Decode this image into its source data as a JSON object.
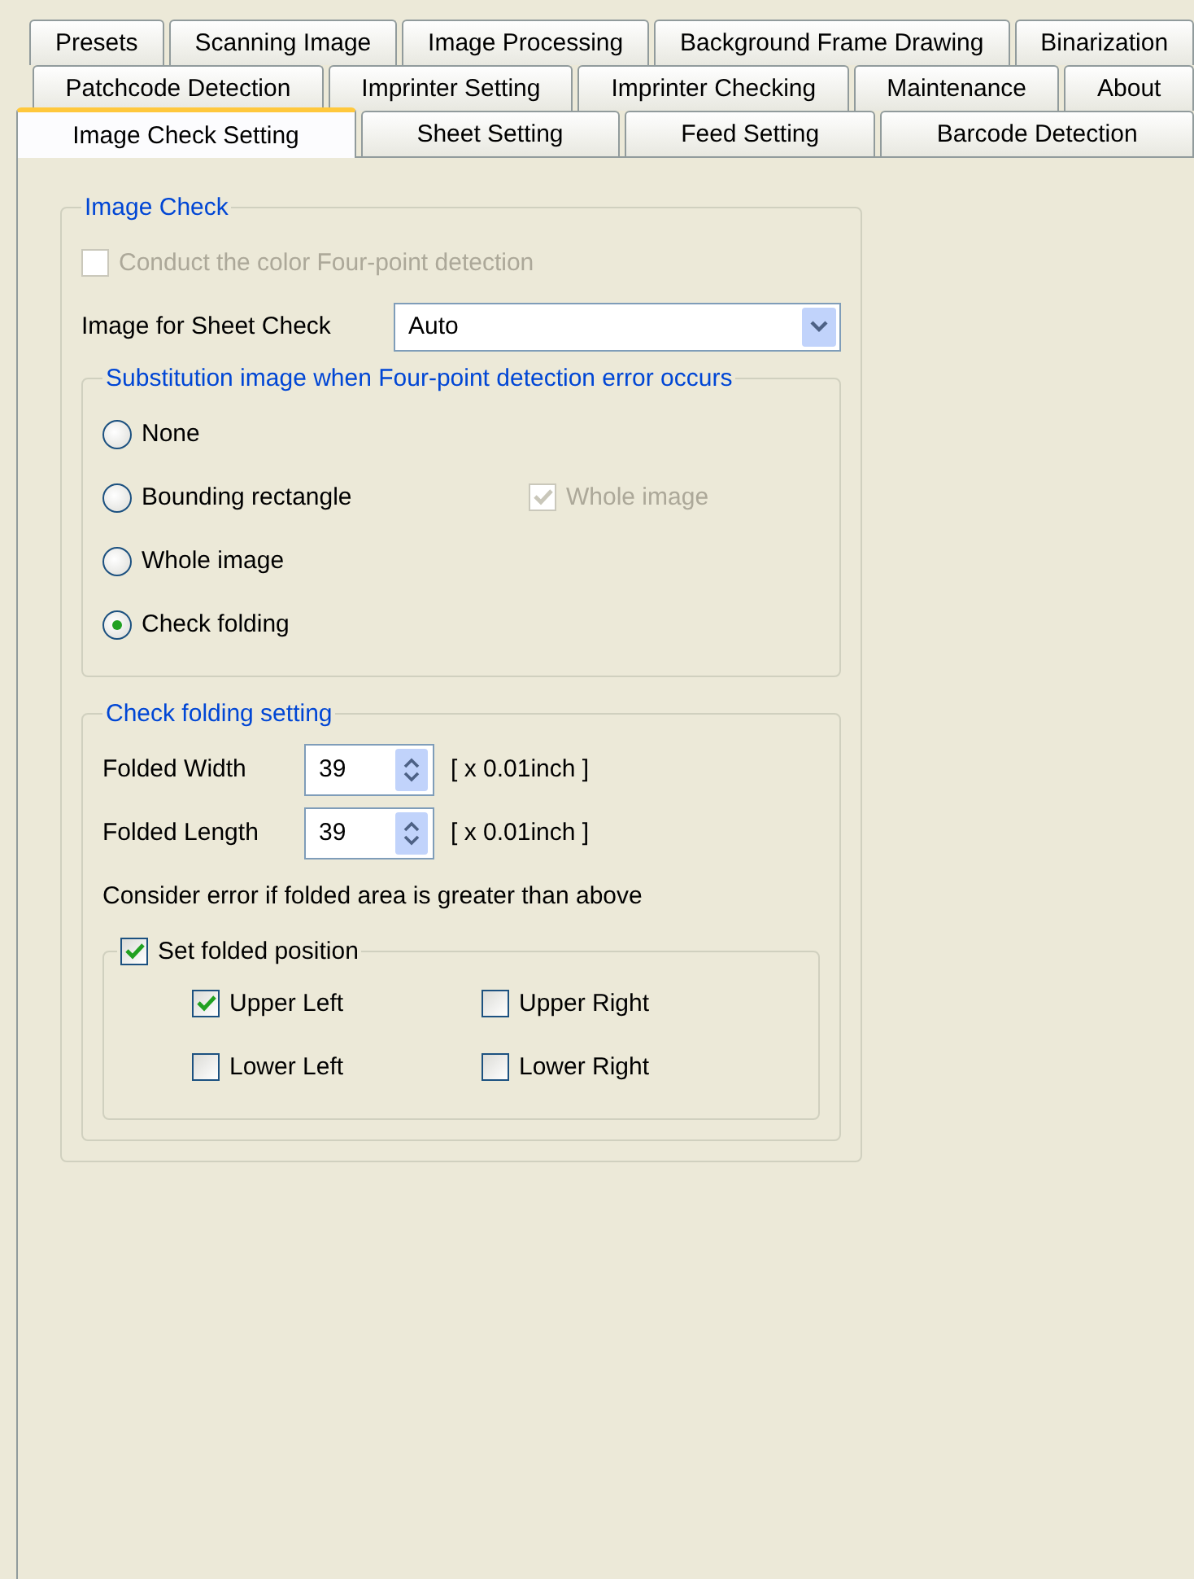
{
  "tab_rows": [
    [
      {
        "label": "Presets",
        "selected": false
      },
      {
        "label": "Scanning Image",
        "selected": false
      },
      {
        "label": "Image Processing",
        "selected": false
      },
      {
        "label": "Background Frame Drawing",
        "selected": false
      },
      {
        "label": "Binarization",
        "selected": false
      }
    ],
    [
      {
        "label": "Patchcode Detection",
        "selected": false
      },
      {
        "label": "Imprinter Setting",
        "selected": false
      },
      {
        "label": "Imprinter Checking",
        "selected": false
      },
      {
        "label": "Maintenance",
        "selected": false
      },
      {
        "label": "About",
        "selected": false
      }
    ],
    [
      {
        "label": "Image Check Setting",
        "selected": true
      },
      {
        "label": "Sheet Setting",
        "selected": false
      },
      {
        "label": "Feed Setting",
        "selected": false
      },
      {
        "label": "Barcode Detection",
        "selected": false
      }
    ]
  ],
  "image_check": {
    "title": "Image Check",
    "color_detection": {
      "label": "Conduct the color Four-point detection",
      "checked": false,
      "disabled": true
    },
    "sheet_check": {
      "label": "Image for Sheet Check",
      "value": "Auto"
    },
    "substitution": {
      "title": "Substitution image when Four-point detection error occurs",
      "options": [
        {
          "label": "None",
          "selected": false
        },
        {
          "label": "Bounding rectangle",
          "selected": false,
          "extra": {
            "label": "Whole image",
            "checked": true,
            "disabled": true
          }
        },
        {
          "label": "Whole image",
          "selected": false
        },
        {
          "label": "Check folding",
          "selected": true
        }
      ]
    },
    "folding": {
      "title": "Check folding setting",
      "fields": [
        {
          "label": "Folded Width",
          "value": "39",
          "unit": "[ x 0.01inch ]"
        },
        {
          "label": "Folded Length",
          "value": "39",
          "unit": "[ x 0.01inch ]"
        }
      ],
      "note": "Consider error if folded area is greater than above",
      "position": {
        "label": "Set folded position",
        "checked": true,
        "options": [
          {
            "label": "Upper Left",
            "checked": true
          },
          {
            "label": "Upper Right",
            "checked": false
          },
          {
            "label": "Lower Left",
            "checked": false
          },
          {
            "label": "Lower Right",
            "checked": false
          }
        ]
      }
    }
  }
}
